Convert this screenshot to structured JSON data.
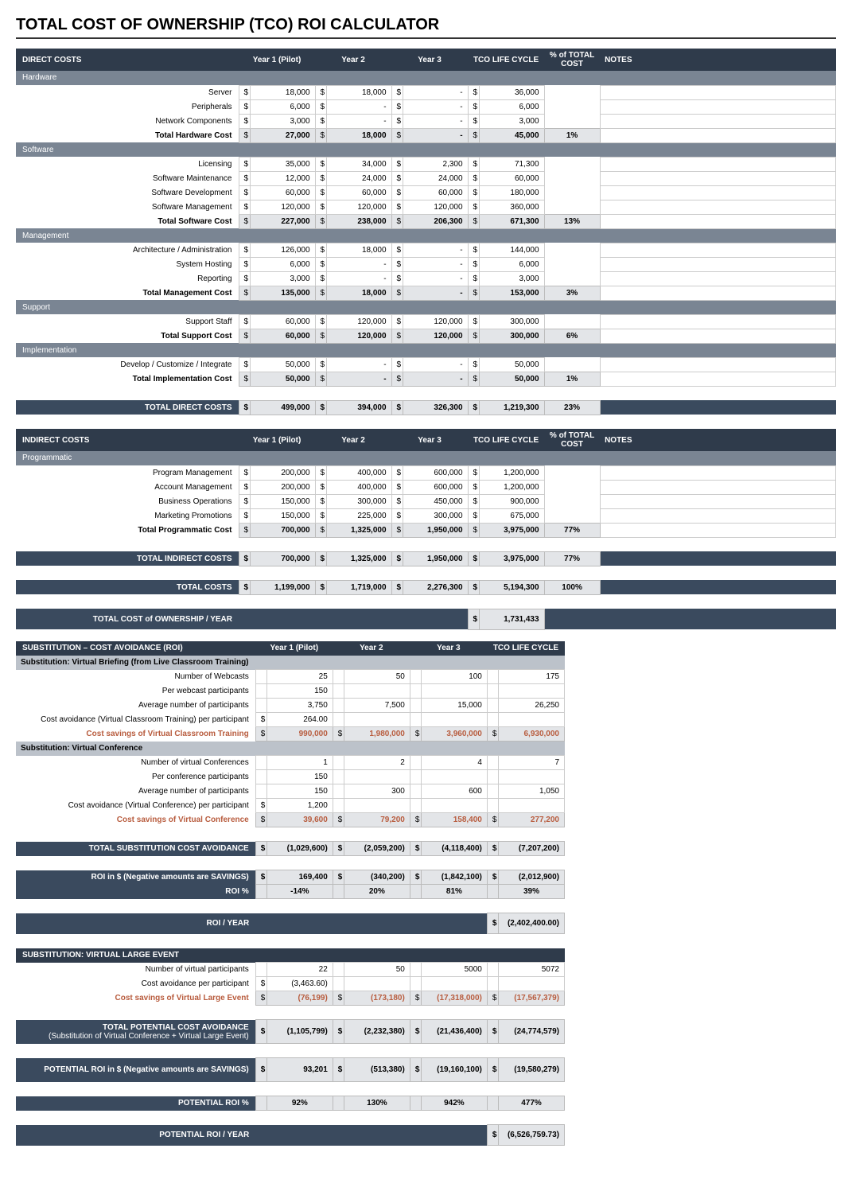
{
  "title": "TOTAL COST OF OWNERSHIP (TCO) ROI CALCULATOR",
  "headers": {
    "direct": "DIRECT COSTS",
    "indirect": "INDIRECT COSTS",
    "y1": "Year 1 (Pilot)",
    "y2": "Year 2",
    "y3": "Year 3",
    "tco": "TCO LIFE CYCLE",
    "pct": "% of TOTAL COST",
    "notes": "NOTES",
    "sub": "SUBSTITUTION – COST AVOIDANCE (ROI)"
  },
  "sections": {
    "hardware": {
      "name": "Hardware",
      "rows": [
        {
          "label": "Server",
          "y1": "18,000",
          "y2": "18,000",
          "y3": "-",
          "tco": "36,000"
        },
        {
          "label": "Peripherals",
          "y1": "6,000",
          "y2": "-",
          "y3": "-",
          "tco": "6,000"
        },
        {
          "label": "Network Components",
          "y1": "3,000",
          "y2": "-",
          "y3": "-",
          "tco": "3,000"
        }
      ],
      "total": {
        "label": "Total Hardware Cost",
        "y1": "27,000",
        "y2": "18,000",
        "y3": "-",
        "tco": "45,000",
        "pct": "1%"
      }
    },
    "software": {
      "name": "Software",
      "rows": [
        {
          "label": "Licensing",
          "y1": "35,000",
          "y2": "34,000",
          "y3": "2,300",
          "tco": "71,300"
        },
        {
          "label": "Software Maintenance",
          "y1": "12,000",
          "y2": "24,000",
          "y3": "24,000",
          "tco": "60,000"
        },
        {
          "label": "Software Development",
          "y1": "60,000",
          "y2": "60,000",
          "y3": "60,000",
          "tco": "180,000"
        },
        {
          "label": "Software Management",
          "y1": "120,000",
          "y2": "120,000",
          "y3": "120,000",
          "tco": "360,000"
        }
      ],
      "total": {
        "label": "Total Software Cost",
        "y1": "227,000",
        "y2": "238,000",
        "y3": "206,300",
        "tco": "671,300",
        "pct": "13%"
      }
    },
    "management": {
      "name": "Management",
      "rows": [
        {
          "label": "Architecture / Administration",
          "y1": "126,000",
          "y2": "18,000",
          "y3": "-",
          "tco": "144,000"
        },
        {
          "label": "System Hosting",
          "y1": "6,000",
          "y2": "-",
          "y3": "-",
          "tco": "6,000"
        },
        {
          "label": "Reporting",
          "y1": "3,000",
          "y2": "-",
          "y3": "-",
          "tco": "3,000"
        }
      ],
      "total": {
        "label": "Total Management Cost",
        "y1": "135,000",
        "y2": "18,000",
        "y3": "-",
        "tco": "153,000",
        "pct": "3%"
      }
    },
    "support": {
      "name": "Support",
      "rows": [
        {
          "label": "Support Staff",
          "y1": "60,000",
          "y2": "120,000",
          "y3": "120,000",
          "tco": "300,000"
        }
      ],
      "total": {
        "label": "Total Support  Cost",
        "y1": "60,000",
        "y2": "120,000",
        "y3": "120,000",
        "tco": "300,000",
        "pct": "6%"
      }
    },
    "impl": {
      "name": "Implementation",
      "rows": [
        {
          "label": "Develop / Customize / Integrate",
          "y1": "50,000",
          "y2": "-",
          "y3": "-",
          "tco": "50,000"
        }
      ],
      "total": {
        "label": "Total Implementation Cost",
        "y1": "50,000",
        "y2": "-",
        "y3": "-",
        "tco": "50,000",
        "pct": "1%"
      }
    },
    "totalDirect": {
      "label": "TOTAL DIRECT COSTS",
      "y1": "499,000",
      "y2": "394,000",
      "y3": "326,300",
      "tco": "1,219,300",
      "pct": "23%"
    },
    "programmatic": {
      "name": "Programmatic",
      "rows": [
        {
          "label": "Program Management",
          "y1": "200,000",
          "y2": "400,000",
          "y3": "600,000",
          "tco": "1,200,000"
        },
        {
          "label": "Account Management",
          "y1": "200,000",
          "y2": "400,000",
          "y3": "600,000",
          "tco": "1,200,000"
        },
        {
          "label": "Business Operations",
          "y1": "150,000",
          "y2": "300,000",
          "y3": "450,000",
          "tco": "900,000"
        },
        {
          "label": "Marketing Promotions",
          "y1": "150,000",
          "y2": "225,000",
          "y3": "300,000",
          "tco": "675,000"
        }
      ],
      "total": {
        "label": "Total Programmatic Cost",
        "y1": "700,000",
        "y2": "1,325,000",
        "y3": "1,950,000",
        "tco": "3,975,000",
        "pct": "77%"
      }
    },
    "totalIndirect": {
      "label": "TOTAL INDIRECT COSTS",
      "y1": "700,000",
      "y2": "1,325,000",
      "y3": "1,950,000",
      "tco": "3,975,000",
      "pct": "77%"
    },
    "totalCosts": {
      "label": "TOTAL COSTS",
      "y1": "1,199,000",
      "y2": "1,719,000",
      "y3": "2,276,300",
      "tco": "5,194,300",
      "pct": "100%"
    },
    "tcoYear": {
      "label": "TOTAL COST of OWNERSHIP / YEAR",
      "tco": "1,731,433"
    }
  },
  "roi": {
    "vb": {
      "name": "Substitution: Virtual Briefing (from Live Classroom Training)",
      "rows": [
        {
          "label": "Number of Webcasts",
          "y1": "25",
          "y2": "50",
          "y3": "100",
          "tco": "175"
        },
        {
          "label": "Per webcast participants",
          "y1": "150",
          "y2": "",
          "y3": "",
          "tco": ""
        },
        {
          "label": "Average number of participants",
          "y1": "3,750",
          "y2": "7,500",
          "y3": "15,000",
          "tco": "26,250"
        },
        {
          "label": "Cost avoidance (Virtual Classroom Training) per participant",
          "d": "$",
          "y1": "264.00",
          "y2": "",
          "y3": "",
          "tco": ""
        }
      ],
      "savings": {
        "label": "Cost savings of Virtual Classroom Training",
        "y1": "990,000",
        "y2": "1,980,000",
        "y3": "3,960,000",
        "tco": "6,930,000"
      }
    },
    "vc": {
      "name": "Substitution: Virtual Conference",
      "rows": [
        {
          "label": "Number of virtual Conferences",
          "y1": "1",
          "y2": "2",
          "y3": "4",
          "tco": "7"
        },
        {
          "label": "Per conference participants",
          "y1": "150",
          "y2": "",
          "y3": "",
          "tco": ""
        },
        {
          "label": "Average number of participants",
          "y1": "150",
          "y2": "300",
          "y3": "600",
          "tco": "1,050"
        },
        {
          "label": "Cost avoidance (Virtual Conference) per participant",
          "d": "$",
          "y1": "1,200",
          "y2": "",
          "y3": "",
          "tco": ""
        }
      ],
      "savings": {
        "label": "Cost savings of Virtual Conference",
        "y1": "39,600",
        "y2": "79,200",
        "y3": "158,400",
        "tco": "277,200"
      }
    },
    "totalSub": {
      "label": "TOTAL SUBSTITUTION COST AVOIDANCE",
      "y1": "(1,029,600)",
      "y2": "(2,059,200)",
      "y3": "(4,118,400)",
      "tco": "(7,207,200)"
    },
    "roiDollar": {
      "label": "ROI in $  (Negative amounts are SAVINGS)",
      "y1": "169,400",
      "y2": "(340,200)",
      "y3": "(1,842,100)",
      "tco": "(2,012,900)"
    },
    "roiPct": {
      "label": "ROI %",
      "y1": "-14%",
      "y2": "20%",
      "y3": "81%",
      "tco": "39%"
    },
    "roiYear": {
      "label": "ROI / YEAR",
      "tco": "(2,402,400.00)"
    },
    "vle": {
      "name": "SUBSTITUTION: VIRTUAL LARGE EVENT",
      "rows": [
        {
          "label": "Number of virtual participants",
          "y1": "22",
          "y2": "50",
          "y3": "5000",
          "tco": "5072"
        },
        {
          "label": "Cost avoidance per participant",
          "d": "$",
          "y1": "(3,463.60)",
          "y2": "",
          "y3": "",
          "tco": ""
        }
      ],
      "savings": {
        "label": "Cost savings of Virtual Large Event",
        "y1": "(76,199)",
        "y2": "(173,180)",
        "y3": "(17,318,000)",
        "tco": "(17,567,379)"
      }
    },
    "totalPot": {
      "label": "TOTAL POTENTIAL COST AVOIDANCE",
      "sub": "(Substitution of Virtual Conference + Virtual Large Event)",
      "y1": "(1,105,799)",
      "y2": "(2,232,380)",
      "y3": "(21,436,400)",
      "tco": "(24,774,579)"
    },
    "potRoiD": {
      "label": "POTENTIAL ROI in $ (Negative amounts are SAVINGS)",
      "y1": "93,201",
      "y2": "(513,380)",
      "y3": "(19,160,100)",
      "tco": "(19,580,279)"
    },
    "potRoiP": {
      "label": "POTENTIAL ROI %",
      "y1": "92%",
      "y2": "130%",
      "y3": "942%",
      "tco": "477%"
    },
    "potRoiY": {
      "label": "POTENTIAL ROI / YEAR",
      "tco": "(6,526,759.73)"
    }
  }
}
